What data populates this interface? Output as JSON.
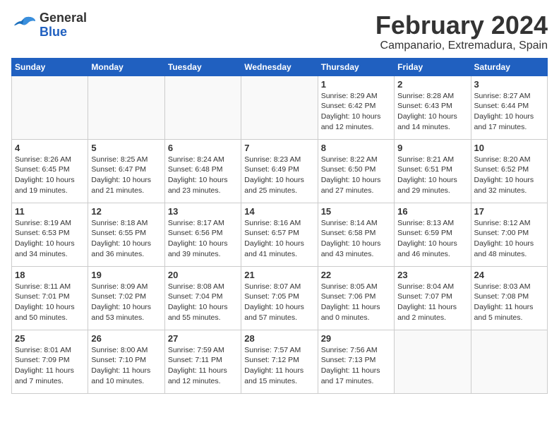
{
  "header": {
    "logo_general": "General",
    "logo_blue": "Blue",
    "month_title": "February 2024",
    "subtitle": "Campanario, Extremadura, Spain"
  },
  "weekdays": [
    "Sunday",
    "Monday",
    "Tuesday",
    "Wednesday",
    "Thursday",
    "Friday",
    "Saturday"
  ],
  "weeks": [
    [
      {
        "day": "",
        "info": ""
      },
      {
        "day": "",
        "info": ""
      },
      {
        "day": "",
        "info": ""
      },
      {
        "day": "",
        "info": ""
      },
      {
        "day": "1",
        "info": "Sunrise: 8:29 AM\nSunset: 6:42 PM\nDaylight: 10 hours\nand 12 minutes."
      },
      {
        "day": "2",
        "info": "Sunrise: 8:28 AM\nSunset: 6:43 PM\nDaylight: 10 hours\nand 14 minutes."
      },
      {
        "day": "3",
        "info": "Sunrise: 8:27 AM\nSunset: 6:44 PM\nDaylight: 10 hours\nand 17 minutes."
      }
    ],
    [
      {
        "day": "4",
        "info": "Sunrise: 8:26 AM\nSunset: 6:45 PM\nDaylight: 10 hours\nand 19 minutes."
      },
      {
        "day": "5",
        "info": "Sunrise: 8:25 AM\nSunset: 6:47 PM\nDaylight: 10 hours\nand 21 minutes."
      },
      {
        "day": "6",
        "info": "Sunrise: 8:24 AM\nSunset: 6:48 PM\nDaylight: 10 hours\nand 23 minutes."
      },
      {
        "day": "7",
        "info": "Sunrise: 8:23 AM\nSunset: 6:49 PM\nDaylight: 10 hours\nand 25 minutes."
      },
      {
        "day": "8",
        "info": "Sunrise: 8:22 AM\nSunset: 6:50 PM\nDaylight: 10 hours\nand 27 minutes."
      },
      {
        "day": "9",
        "info": "Sunrise: 8:21 AM\nSunset: 6:51 PM\nDaylight: 10 hours\nand 29 minutes."
      },
      {
        "day": "10",
        "info": "Sunrise: 8:20 AM\nSunset: 6:52 PM\nDaylight: 10 hours\nand 32 minutes."
      }
    ],
    [
      {
        "day": "11",
        "info": "Sunrise: 8:19 AM\nSunset: 6:53 PM\nDaylight: 10 hours\nand 34 minutes."
      },
      {
        "day": "12",
        "info": "Sunrise: 8:18 AM\nSunset: 6:55 PM\nDaylight: 10 hours\nand 36 minutes."
      },
      {
        "day": "13",
        "info": "Sunrise: 8:17 AM\nSunset: 6:56 PM\nDaylight: 10 hours\nand 39 minutes."
      },
      {
        "day": "14",
        "info": "Sunrise: 8:16 AM\nSunset: 6:57 PM\nDaylight: 10 hours\nand 41 minutes."
      },
      {
        "day": "15",
        "info": "Sunrise: 8:14 AM\nSunset: 6:58 PM\nDaylight: 10 hours\nand 43 minutes."
      },
      {
        "day": "16",
        "info": "Sunrise: 8:13 AM\nSunset: 6:59 PM\nDaylight: 10 hours\nand 46 minutes."
      },
      {
        "day": "17",
        "info": "Sunrise: 8:12 AM\nSunset: 7:00 PM\nDaylight: 10 hours\nand 48 minutes."
      }
    ],
    [
      {
        "day": "18",
        "info": "Sunrise: 8:11 AM\nSunset: 7:01 PM\nDaylight: 10 hours\nand 50 minutes."
      },
      {
        "day": "19",
        "info": "Sunrise: 8:09 AM\nSunset: 7:02 PM\nDaylight: 10 hours\nand 53 minutes."
      },
      {
        "day": "20",
        "info": "Sunrise: 8:08 AM\nSunset: 7:04 PM\nDaylight: 10 hours\nand 55 minutes."
      },
      {
        "day": "21",
        "info": "Sunrise: 8:07 AM\nSunset: 7:05 PM\nDaylight: 10 hours\nand 57 minutes."
      },
      {
        "day": "22",
        "info": "Sunrise: 8:05 AM\nSunset: 7:06 PM\nDaylight: 11 hours\nand 0 minutes."
      },
      {
        "day": "23",
        "info": "Sunrise: 8:04 AM\nSunset: 7:07 PM\nDaylight: 11 hours\nand 2 minutes."
      },
      {
        "day": "24",
        "info": "Sunrise: 8:03 AM\nSunset: 7:08 PM\nDaylight: 11 hours\nand 5 minutes."
      }
    ],
    [
      {
        "day": "25",
        "info": "Sunrise: 8:01 AM\nSunset: 7:09 PM\nDaylight: 11 hours\nand 7 minutes."
      },
      {
        "day": "26",
        "info": "Sunrise: 8:00 AM\nSunset: 7:10 PM\nDaylight: 11 hours\nand 10 minutes."
      },
      {
        "day": "27",
        "info": "Sunrise: 7:59 AM\nSunset: 7:11 PM\nDaylight: 11 hours\nand 12 minutes."
      },
      {
        "day": "28",
        "info": "Sunrise: 7:57 AM\nSunset: 7:12 PM\nDaylight: 11 hours\nand 15 minutes."
      },
      {
        "day": "29",
        "info": "Sunrise: 7:56 AM\nSunset: 7:13 PM\nDaylight: 11 hours\nand 17 minutes."
      },
      {
        "day": "",
        "info": ""
      },
      {
        "day": "",
        "info": ""
      }
    ]
  ]
}
